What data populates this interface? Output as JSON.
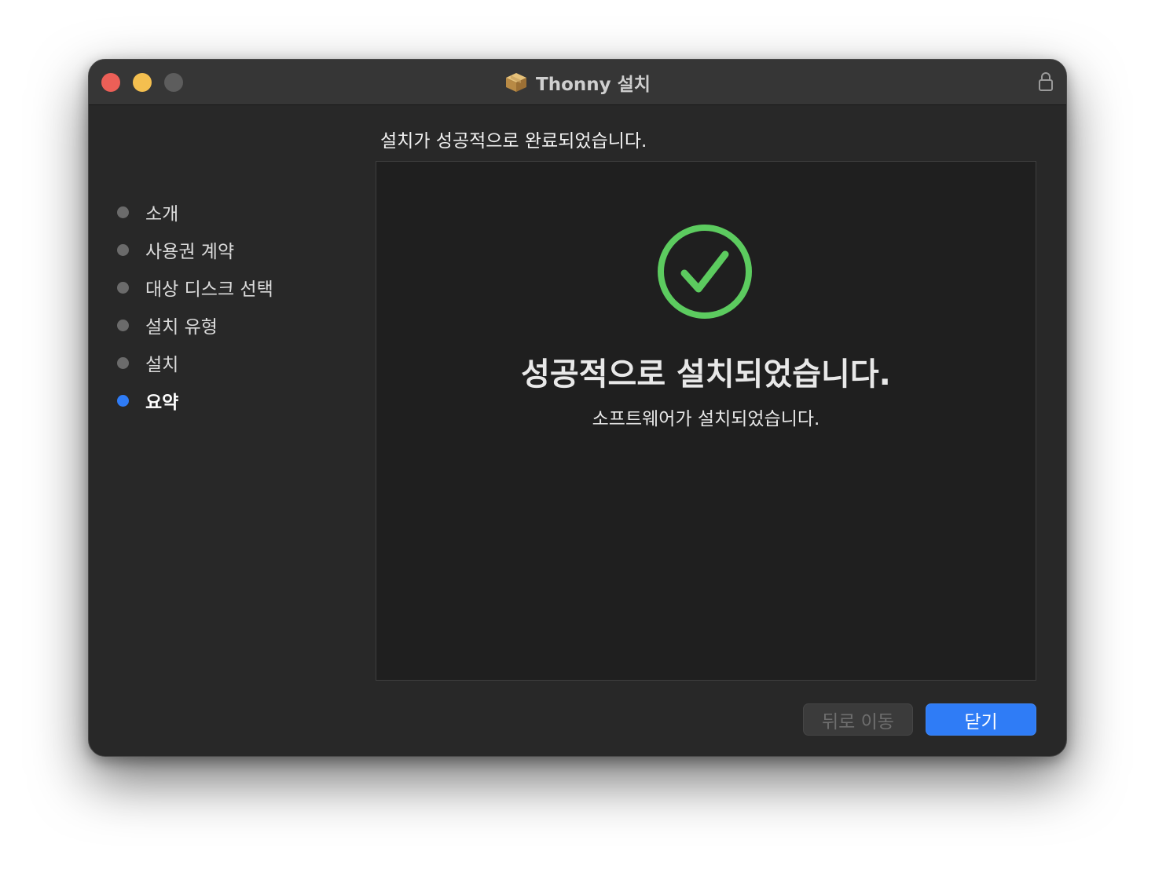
{
  "window": {
    "title": "Thonny 설치"
  },
  "icons": {
    "title": "package-installer-icon",
    "lock": "lock-icon",
    "status": "checkmark-circle-icon"
  },
  "colors": {
    "accent": "#2f7cf6",
    "success": "#5ccb5f"
  },
  "sidebar": {
    "steps": [
      {
        "label": "소개",
        "active": false
      },
      {
        "label": "사용권 계약",
        "active": false
      },
      {
        "label": "대상 디스크 선택",
        "active": false
      },
      {
        "label": "설치 유형",
        "active": false
      },
      {
        "label": "설치",
        "active": false
      },
      {
        "label": "요약",
        "active": true
      }
    ]
  },
  "main": {
    "header": "설치가 성공적으로 완료되었습니다.",
    "success_title": "성공적으로 설치되었습니다.",
    "success_subtitle": "소프트웨어가 설치되었습니다."
  },
  "buttons": {
    "back_label": "뒤로 이동",
    "back_enabled": false,
    "close_label": "닫기"
  }
}
